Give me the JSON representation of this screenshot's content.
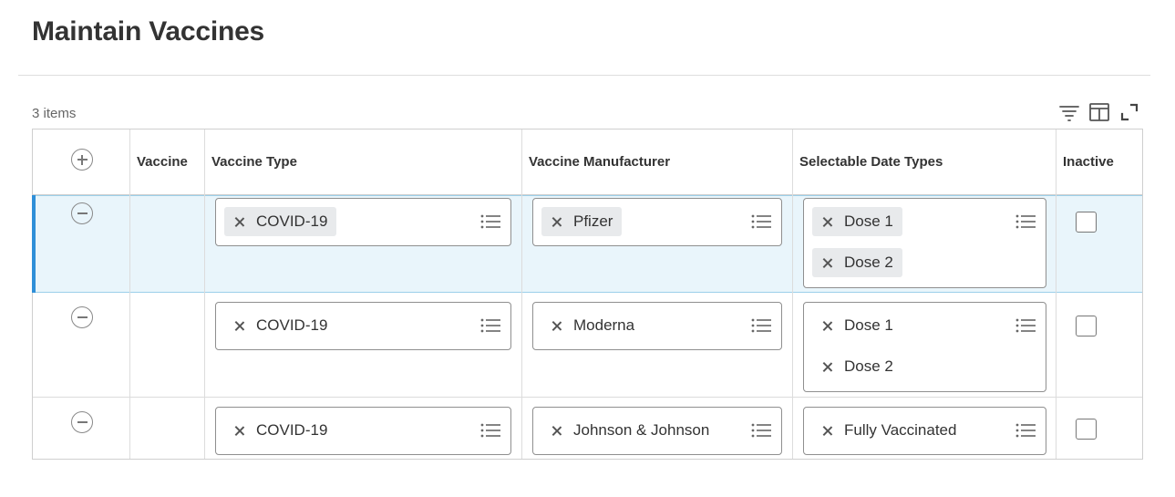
{
  "page": {
    "title": "Maintain Vaccines",
    "item_count": "3 items"
  },
  "toolbar": {
    "icons": [
      "filter-icon",
      "column-layout-icon",
      "expand-icon"
    ]
  },
  "table": {
    "columns": [
      "Vaccine",
      "Vaccine Type",
      "Vaccine Manufacturer",
      "Selectable Date Types",
      "Inactive"
    ],
    "rows": [
      {
        "vaccine": "",
        "vaccine_type": "COVID-19",
        "manufacturer": "Pfizer",
        "date_types": [
          "Dose 1",
          "Dose 2"
        ],
        "inactive": false
      },
      {
        "vaccine": "",
        "vaccine_type": "COVID-19",
        "manufacturer": "Moderna",
        "date_types": [
          "Dose 1",
          "Dose 2"
        ],
        "inactive": false
      },
      {
        "vaccine": "",
        "vaccine_type": "COVID-19",
        "manufacturer": "Johnson & Johnson",
        "date_types": [
          "Fully Vaccinated"
        ],
        "inactive": false
      }
    ]
  },
  "colors": {
    "selected_row_bg": "#e9f5fb",
    "selected_row_accent": "#2f8fd8",
    "pill_bg": "#e8eaec"
  }
}
